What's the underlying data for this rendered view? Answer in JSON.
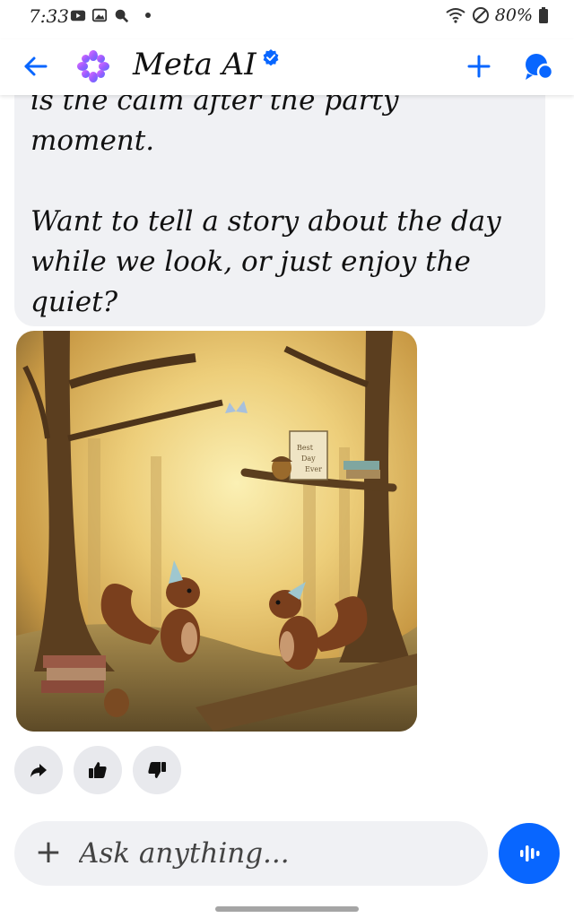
{
  "status_bar": {
    "time": "7:33",
    "battery": "80%",
    "icons": [
      "youtube-icon",
      "gallery-icon",
      "search-lens-icon",
      "dot-icon",
      "wifi-icon",
      "do-not-disturb-icon",
      "battery-icon"
    ]
  },
  "header": {
    "title": "Meta AI",
    "back_icon": "back-arrow-icon",
    "logo_icon": "meta-ai-logo-icon",
    "verified_icon": "verified-badge-icon",
    "new_chat_icon": "plus-icon",
    "chats_icon": "chat-bubbles-icon",
    "accent_color": "#0866ff"
  },
  "message": {
    "partial_line": "is the calm after the party",
    "line_end": "moment.",
    "paragraph": "Want to tell a story about the day while we look, or just enjoy the quiet?"
  },
  "image": {
    "description_icon": "generated-image",
    "book_label_1": "Best",
    "book_label_2": "Day",
    "book_label_3": "Ever"
  },
  "reactions": {
    "share_icon": "share-arrow-icon",
    "like_icon": "thumbs-up-icon",
    "dislike_icon": "thumbs-down-icon"
  },
  "composer": {
    "plus_label": "+",
    "placeholder": "Ask anything...",
    "voice_icon": "voice-waveform-icon"
  }
}
